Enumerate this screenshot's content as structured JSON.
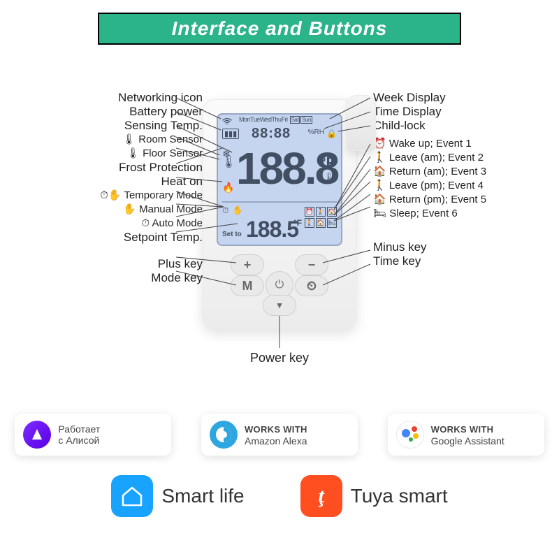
{
  "title": "Interface and Buttons",
  "device": {
    "lcd": {
      "days": [
        "Mon",
        "Tue",
        "Wed",
        "Thu",
        "Fri",
        "Sat",
        "Sun"
      ],
      "time_digits": "88:88",
      "rh_unit": "%RH",
      "big_temp": "188.8",
      "unit_f": "°F",
      "set_to_label": "Set to",
      "set_temp": "188.5",
      "set_unit": "°F"
    },
    "keys": {
      "plus": "+",
      "minus": "−",
      "mode": "M",
      "time": "⏲",
      "power": "⏻",
      "down": "▾"
    }
  },
  "labels_left": {
    "networking": "Networking icon",
    "battery": "Battery power",
    "sensing_temp": "Sensing Temp.",
    "room_sensor": "🌡 Room Sensor",
    "floor_sensor": "🌡 Floor Sensor",
    "frost": "Frost Protection",
    "heat_on": "Heat on",
    "temp_mode": "⏱✋ Temporary Mode",
    "manual_mode": "✋ Manual Mode",
    "auto_mode": "⏱ Auto Mode",
    "setpoint": "Setpoint Temp.",
    "plus_key": "Plus key",
    "mode_key": "Mode key"
  },
  "labels_right": {
    "week": "Week Display",
    "time": "Time Display",
    "childlock": "Child-lock",
    "events": [
      "⏰ Wake up; Event 1",
      "🚶 Leave (am); Event 2",
      "🏠 Return (am); Event 3",
      "🚶 Leave (pm); Event 4",
      "🏠 Return (pm); Event 5",
      "🛏 Sleep; Event 6"
    ],
    "minus_key": "Minus key",
    "time_key": "Time key"
  },
  "labels_bottom": {
    "power_key": "Power key"
  },
  "badges": {
    "alisa": {
      "line1": "Работает",
      "line2": "с Алисой"
    },
    "alexa": {
      "line1": "WORKS WITH",
      "line2": "Amazon Alexa"
    },
    "google": {
      "line1": "WORKS WITH",
      "line2": "Google Assistant"
    }
  },
  "apps": {
    "smartlife": "Smart life",
    "tuya": "Tuya smart",
    "tuya_glyph": "ţ"
  }
}
